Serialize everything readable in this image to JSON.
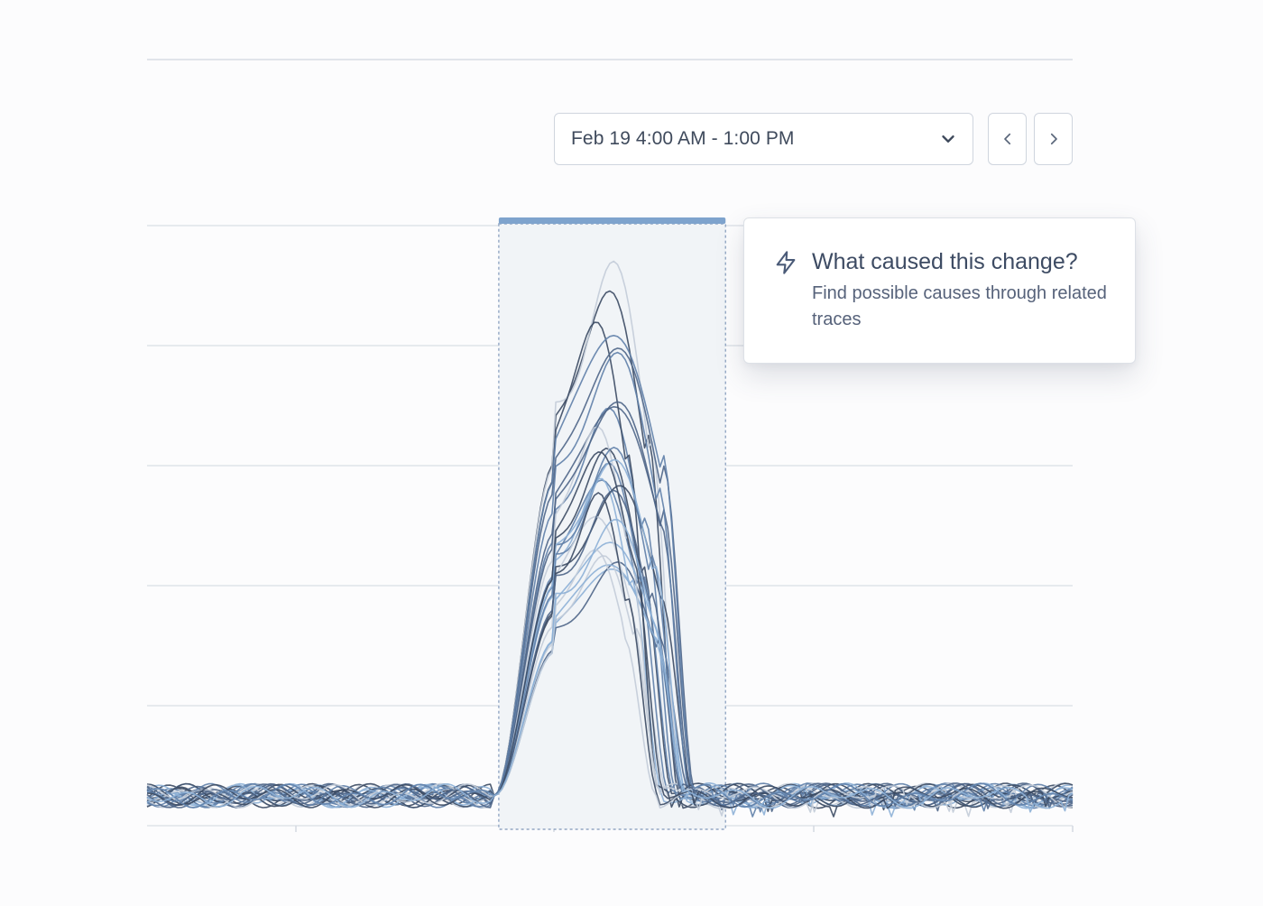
{
  "time_range": {
    "value": "Feb 19 4:00 AM - 1:00 PM",
    "dropdown_icon": "chevron-down-icon",
    "prev_icon": "chevron-left-icon",
    "next_icon": "chevron-right-icon"
  },
  "insight": {
    "icon": "lightning-bolt-icon",
    "title": "What caused this change?",
    "description": "Find possible causes through related traces"
  },
  "colors": {
    "selection_accent": "#7ea3cd",
    "selection_fill": "#f1f4f7",
    "series_palette": [
      "#3b4a63",
      "#5f7fa8",
      "#8db0d6",
      "#c3ccd8",
      "#4e6587"
    ]
  },
  "chart_data": {
    "type": "line",
    "series_count": 28,
    "x_ticks": 4,
    "y_gridlines": 5,
    "selection": {
      "start_fraction": 0.38,
      "end_fraction": 0.625
    },
    "baseline_level": 0.05,
    "peak_range": [
      0.4,
      0.88
    ],
    "axis_labels_visible": false,
    "legend_visible": false
  }
}
